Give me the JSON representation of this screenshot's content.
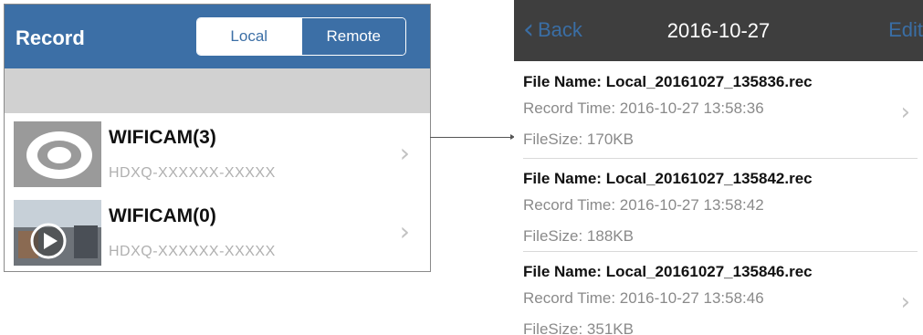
{
  "left_panel": {
    "title": "Record",
    "tabs": [
      "Local",
      "Remote"
    ],
    "selected_tab": "Local",
    "cameras": [
      {
        "name": "WIFICAM(3)",
        "id": "HDXQ-XXXXXX-XXXXX"
      },
      {
        "name": "WIFICAM(0)",
        "id": "HDXQ-XXXXXX-XXXXX"
      }
    ],
    "header_color": "#3c6fa6"
  },
  "right_panel": {
    "back_label": "Back",
    "title": "2016-10-27",
    "edit_label": "Edit",
    "files": [
      {
        "name": "File Name: Local_20161027_135836.rec",
        "time": "Record Time: 2016-10-27 13:58:36",
        "size": "FileSize: 170KB"
      },
      {
        "name": "File Name: Local_20161027_135842.rec",
        "time": "Record Time: 2016-10-27 13:58:42",
        "size": "FileSize: 188KB"
      },
      {
        "name": "File Name: Local_20161027_135846.rec",
        "time": "Record Time: 2016-10-27 13:58:46",
        "size": "FileSize: 351KB"
      }
    ],
    "header_color": "#3e3e3e",
    "accent_color": "#3a6ea5"
  },
  "icons": {
    "chevron": "chevron-right-icon",
    "back": "chevron-left-icon",
    "play": "play-icon",
    "camera": "camera-lens-icon"
  }
}
